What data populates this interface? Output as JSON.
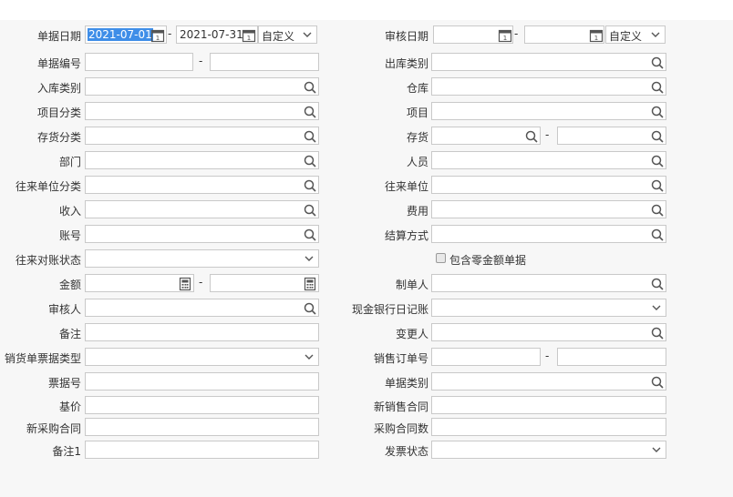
{
  "form": {
    "doc_date_label": "单据日期",
    "doc_date_from": "2021-07-01",
    "doc_date_to": "2021-07-31",
    "doc_date_mode": "自定义",
    "audit_date_label": "审核日期",
    "audit_date_mode": "自定义",
    "doc_no_label": "单据编号",
    "outbound_type_label": "出库类别",
    "inbound_type_label": "入库类别",
    "warehouse_label": "仓库",
    "project_class_label": "项目分类",
    "project_label": "项目",
    "inventory_class_label": "存货分类",
    "inventory_label": "存货",
    "dept_label": "部门",
    "person_label": "人员",
    "partner_class_label": "往来单位分类",
    "partner_label": "往来单位",
    "income_label": "收入",
    "expense_label": "费用",
    "account_label": "账号",
    "settle_label": "结算方式",
    "reconcile_label": "往来对账状态",
    "zero_amount_label": "包含零金额单据",
    "amount_label": "金额",
    "maker_label": "制单人",
    "auditor_label": "审核人",
    "cash_journal_label": "现金银行日记账",
    "remark_label": "备注",
    "changer_label": "变更人",
    "sales_doc_type_label": "销货单票据类型",
    "sales_order_label": "销售订单号",
    "ticket_no_label": "票据号",
    "doc_category_label": "单据类别",
    "base_price_label": "基价",
    "new_sales_contract_label": "新销售合同",
    "new_purchase_contract_label": "新采购合同",
    "purchase_contract_count_label": "采购合同数",
    "remark1_label": "备注1",
    "invoice_status_label": "发票状态",
    "range_separator": "-"
  }
}
